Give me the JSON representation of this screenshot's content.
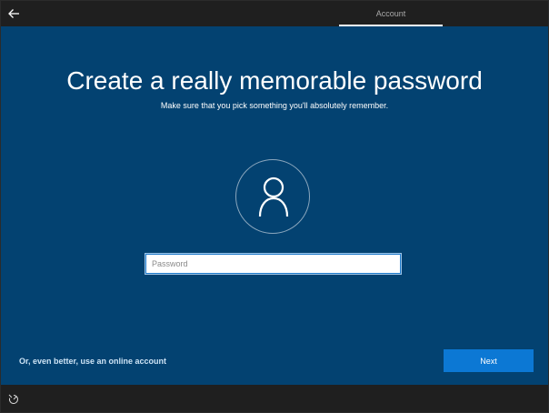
{
  "header": {
    "active_tab": "Account"
  },
  "icons": {
    "back": "back-arrow-icon",
    "avatar": "user-icon",
    "ease_of_access": "ease-of-access-icon"
  },
  "main": {
    "title": "Create a really memorable password",
    "subtitle": "Make sure that you pick something you'll absolutely remember.",
    "password_field": {
      "placeholder": "Password",
      "value": ""
    },
    "online_account_link": "Or, even better, use an online account",
    "next_label": "Next"
  },
  "colors": {
    "background": "#034271",
    "chrome": "#1f1f1f",
    "accent": "#0c78d4"
  }
}
